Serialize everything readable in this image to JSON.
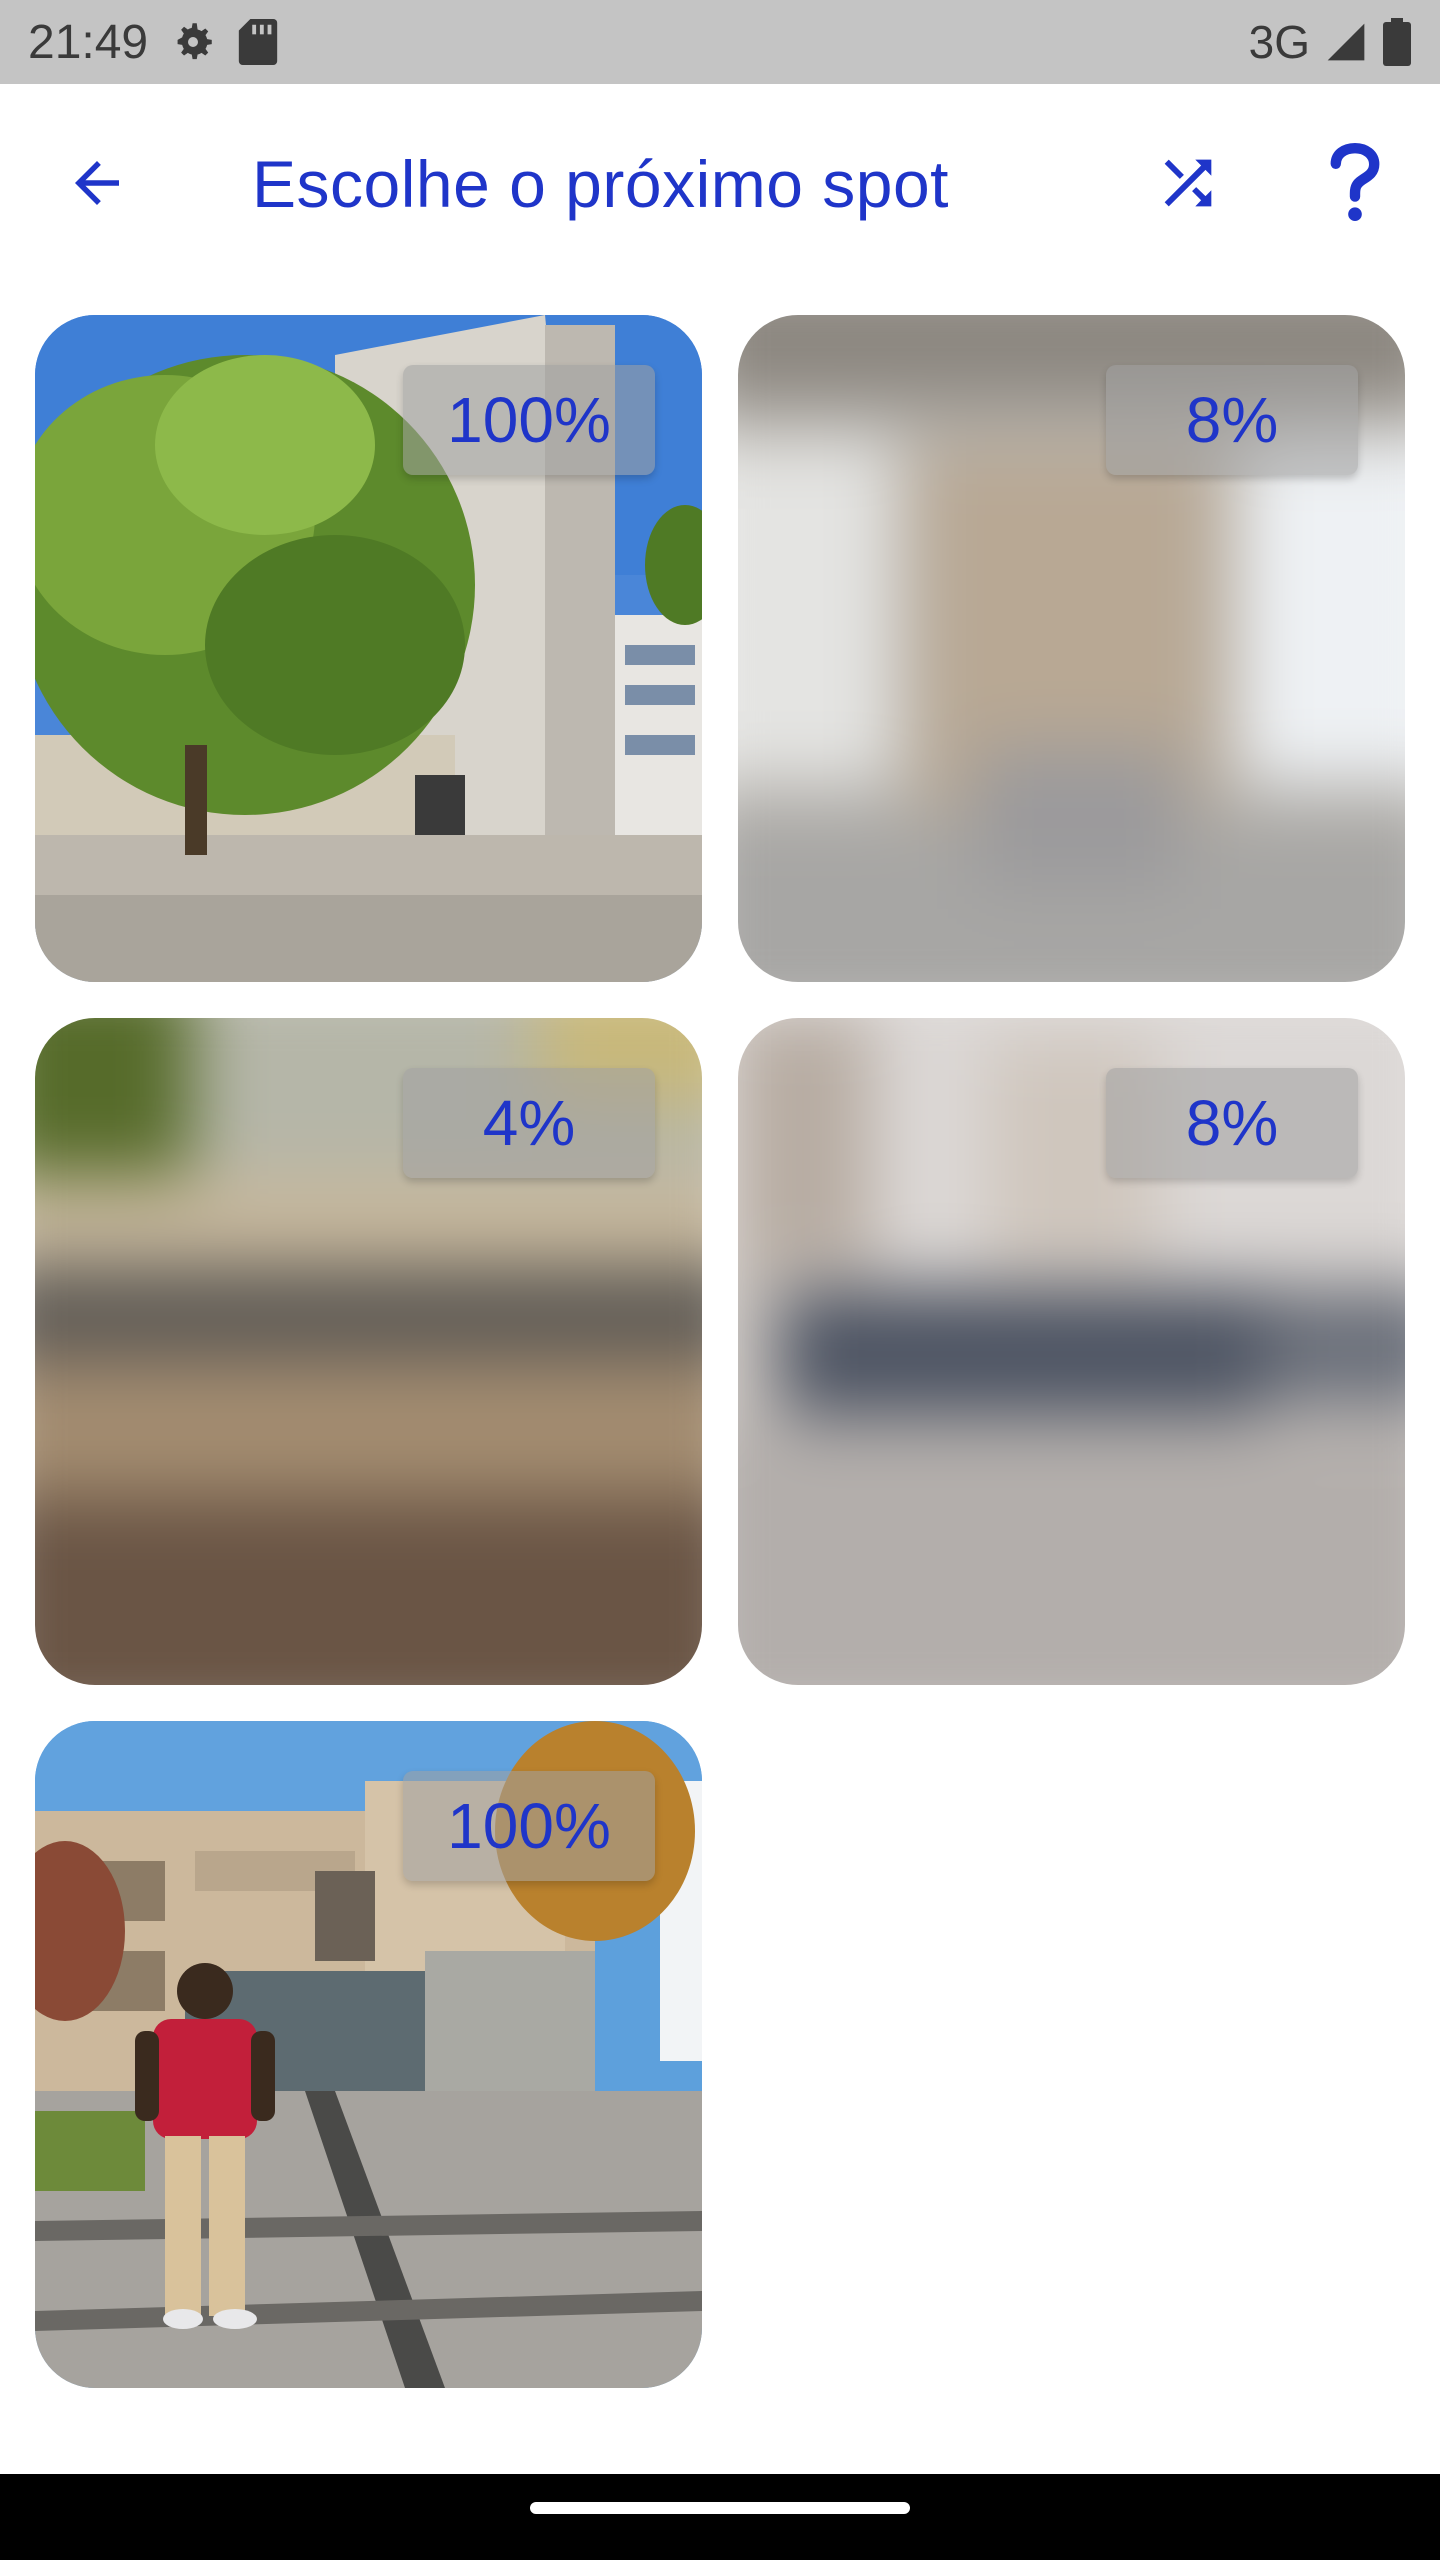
{
  "status_bar": {
    "time": "21:49",
    "network": "3G",
    "icons": [
      "settings-icon",
      "sd-card-icon",
      "signal-icon",
      "battery-icon"
    ]
  },
  "app_bar": {
    "title": "Escolhe o próximo spot",
    "back_icon": "arrow-back-icon",
    "shuffle_icon": "shuffle-icon",
    "help_icon": "help-icon",
    "accent_color": "#1f35c9"
  },
  "spots": [
    {
      "percent": "100%",
      "revealed": true,
      "scene": "building-with-tree"
    },
    {
      "percent": "8%",
      "revealed": false,
      "scene": "blurred-interior"
    },
    {
      "percent": "4%",
      "revealed": false,
      "scene": "blurred-outdoor"
    },
    {
      "percent": "8%",
      "revealed": false,
      "scene": "blurred-hall"
    },
    {
      "percent": "100%",
      "revealed": true,
      "scene": "man-in-front-of-school"
    }
  ]
}
